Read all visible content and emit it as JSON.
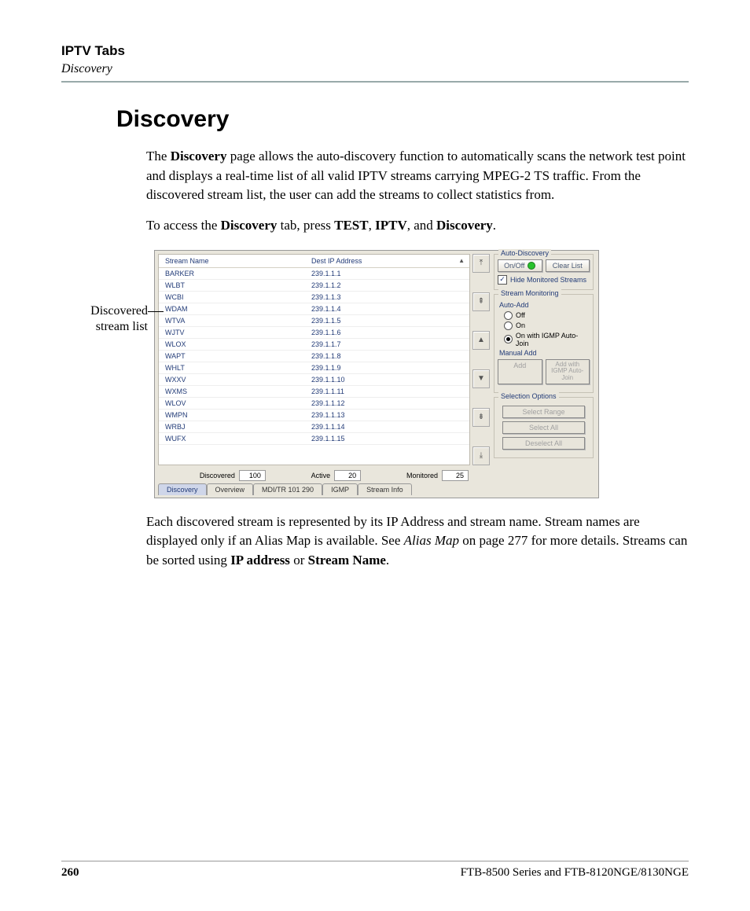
{
  "header": {
    "section": "IPTV Tabs",
    "subsection": "Discovery"
  },
  "title": "Discovery",
  "para1": {
    "t1": "The ",
    "b1": "Discovery",
    "t2": " page allows the auto-discovery function to automatically scans the network test point and displays a real-time list of all valid IPTV streams carrying MPEG-2 TS traffic. From the discovered stream list, the user can add the streams to collect statistics from."
  },
  "para2": {
    "t1": "To access the ",
    "b1": "Discovery",
    "t2": " tab, press ",
    "b2": "TEST",
    "t3": ", ",
    "b3": "IPTV",
    "t4": ", and ",
    "b4": "Discovery",
    "t5": "."
  },
  "callout": "Discovered stream list",
  "table": {
    "col_name": "Stream Name",
    "col_ip": "Dest IP Address",
    "rows": [
      {
        "name": "BARKER",
        "ip": "239.1.1.1"
      },
      {
        "name": "WLBT",
        "ip": "239.1.1.2"
      },
      {
        "name": "WCBI",
        "ip": "239.1.1.3"
      },
      {
        "name": "WDAM",
        "ip": "239.1.1.4"
      },
      {
        "name": "WTVA",
        "ip": "239.1.1.5"
      },
      {
        "name": "WJTV",
        "ip": "239.1.1.6"
      },
      {
        "name": "WLOX",
        "ip": "239.1.1.7"
      },
      {
        "name": "WAPT",
        "ip": "239.1.1.8"
      },
      {
        "name": "WHLT",
        "ip": "239.1.1.9"
      },
      {
        "name": "WXXV",
        "ip": "239.1.1.10"
      },
      {
        "name": "WXMS",
        "ip": "239.1.1.11"
      },
      {
        "name": "WLOV",
        "ip": "239.1.1.12"
      },
      {
        "name": "WMPN",
        "ip": "239.1.1.13"
      },
      {
        "name": "WRBJ",
        "ip": "239.1.1.14"
      },
      {
        "name": "WUFX",
        "ip": "239.1.1.15"
      }
    ]
  },
  "status": {
    "discovered_label": "Discovered",
    "discovered_value": "100",
    "active_label": "Active",
    "active_value": "20",
    "monitored_label": "Monitored",
    "monitored_value": "25"
  },
  "tabs": {
    "discovery": "Discovery",
    "overview": "Overview",
    "mdi": "MDI/TR 101 290",
    "igmp": "IGMP",
    "stream_info": "Stream Info"
  },
  "panel": {
    "auto_discovery": "Auto-Discovery",
    "onoff": "On/Off",
    "clear_list": "Clear List",
    "hide_monitored": "Hide Monitored Streams",
    "stream_monitoring": "Stream Monitoring",
    "auto_add": "Auto-Add",
    "off": "Off",
    "on": "On",
    "on_igmp": "On with IGMP Auto-Join",
    "manual_add": "Manual Add",
    "add": "Add",
    "add_igmp": "Add with IGMP Auto-Join",
    "selection_options": "Selection Options",
    "select_range": "Select Range",
    "select_all": "Select All",
    "deselect_all": "Deselect All"
  },
  "para3": {
    "t1": "Each discovered stream is represented by its IP Address and stream name. Stream names are displayed only if an Alias Map is available. See ",
    "i1": "Alias Map",
    "t2": " on page 277 for more details. Streams can be sorted using ",
    "b1": "IP address",
    "t3": " or ",
    "b2": "Stream Name",
    "t4": "."
  },
  "footer": {
    "page": "260",
    "product": "FTB-8500 Series and FTB-8120NGE/8130NGE"
  }
}
